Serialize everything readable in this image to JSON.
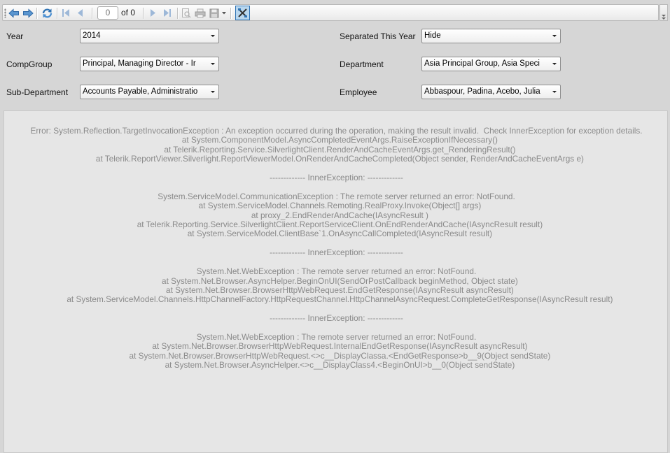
{
  "toolbar": {
    "page_input_value": "0",
    "page_of_label": "of 0"
  },
  "icons": {
    "back": "back-arrow-icon",
    "forward": "forward-arrow-icon",
    "refresh": "refresh-icon",
    "first_page": "first-page-icon",
    "previous_page": "previous-page-icon",
    "next_page": "next-page-icon",
    "last_page": "last-page-icon",
    "print_preview": "print-preview-icon",
    "print": "print-icon",
    "export": "save-disk-icon",
    "parameters": "parameters-toggle-icon"
  },
  "colors": {
    "background": "#d6d6d6",
    "report_background": "#e6e6e6",
    "error_text": "#8a8a8a",
    "active_button": "#b9d7ef",
    "icon_blue": "#2f73b4"
  },
  "parameters": {
    "year": {
      "label": "Year",
      "value": "2014"
    },
    "separated": {
      "label": "Separated This Year",
      "value": "Hide"
    },
    "compgroup": {
      "label": "CompGroup",
      "value": "Principal, Managing Director - Ir"
    },
    "department": {
      "label": "Department",
      "value": "Asia Principal Group, Asia Speci"
    },
    "subdepartment": {
      "label": "Sub-Department",
      "value": "Accounts Payable, Administratio"
    },
    "employee": {
      "label": "Employee",
      "value": "Abbaspour, Padina, Acebo, Julia"
    }
  },
  "report": {
    "error_message": "Error: System.Reflection.TargetInvocationException : An exception occurred during the operation, making the result invalid.  Check InnerException for exception details.\n   at System.ComponentModel.AsyncCompletedEventArgs.RaiseExceptionIfNecessary()\n   at Telerik.Reporting.Service.SilverlightClient.RenderAndCacheEventArgs.get_RenderingResult()\n   at Telerik.ReportViewer.Silverlight.ReportViewerModel.OnRenderAndCacheCompleted(Object sender, RenderAndCacheEventArgs e)\n\n------------- InnerException: -------------\n\nSystem.ServiceModel.CommunicationException : The remote server returned an error: NotFound.\n   at System.ServiceModel.Channels.Remoting.RealProxy.Invoke(Object[] args)\n   at proxy_2.EndRenderAndCache(IAsyncResult )\n   at Telerik.Reporting.Service.SilverlightClient.ReportServiceClient.OnEndRenderAndCache(IAsyncResult result)\n   at System.ServiceModel.ClientBase`1.OnAsyncCallCompleted(IAsyncResult result)\n\n------------- InnerException: -------------\n\nSystem.Net.WebException : The remote server returned an error: NotFound.\n   at System.Net.Browser.AsyncHelper.BeginOnUI(SendOrPostCallback beginMethod, Object state)\n   at System.Net.Browser.BrowserHttpWebRequest.EndGetResponse(IAsyncResult asyncResult)\n   at System.ServiceModel.Channels.HttpChannelFactory.HttpRequestChannel.HttpChannelAsyncRequest.CompleteGetResponse(IAsyncResult result)\n\n------------- InnerException: -------------\n\nSystem.Net.WebException : The remote server returned an error: NotFound.\n   at System.Net.Browser.BrowserHttpWebRequest.InternalEndGetResponse(IAsyncResult asyncResult)\n   at System.Net.Browser.BrowserHttpWebRequest.<>c__DisplayClassa.<EndGetResponse>b__9(Object sendState)\n   at System.Net.Browser.AsyncHelper.<>c__DisplayClass4.<BeginOnUI>b__0(Object sendState)"
  }
}
